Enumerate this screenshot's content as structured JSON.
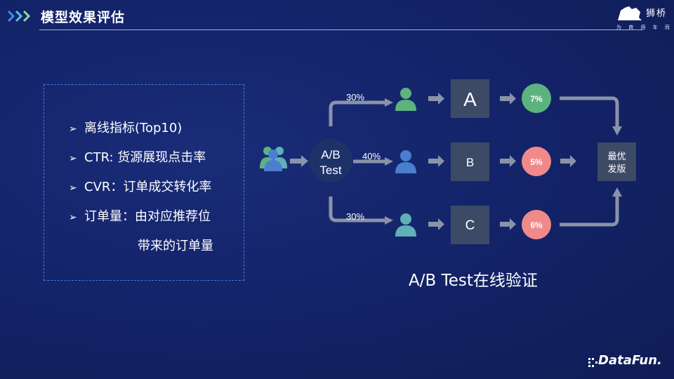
{
  "header": {
    "title": "模型效果评估"
  },
  "logo": {
    "name": "狮桥",
    "subtitle": "为 商 用 车 而 生"
  },
  "metrics": {
    "items": [
      "离线指标(Top10)",
      "CTR: 货源展现点击率",
      "CVR：订单成交转化率",
      "订单量：由对应推荐位"
    ],
    "continuation": "带来的订单量"
  },
  "abtest": {
    "splitter": [
      "A/B",
      "Test"
    ],
    "branches": [
      {
        "share": "30%",
        "variant": "A",
        "result": "7%",
        "result_color": "#5db37e",
        "user_color": "#5db37e"
      },
      {
        "share": "40%",
        "variant": "B",
        "result": "5%",
        "result_color": "#f08a8a",
        "user_color": "#4a7fd0"
      },
      {
        "share": "30%",
        "variant": "C",
        "result": "6%",
        "result_color": "#f08a8a",
        "user_color": "#5fb0b8"
      }
    ],
    "release": [
      "最优",
      "发版"
    ]
  },
  "caption": "A/B Test在线验证",
  "footer": {
    "brand": "DataFun."
  }
}
